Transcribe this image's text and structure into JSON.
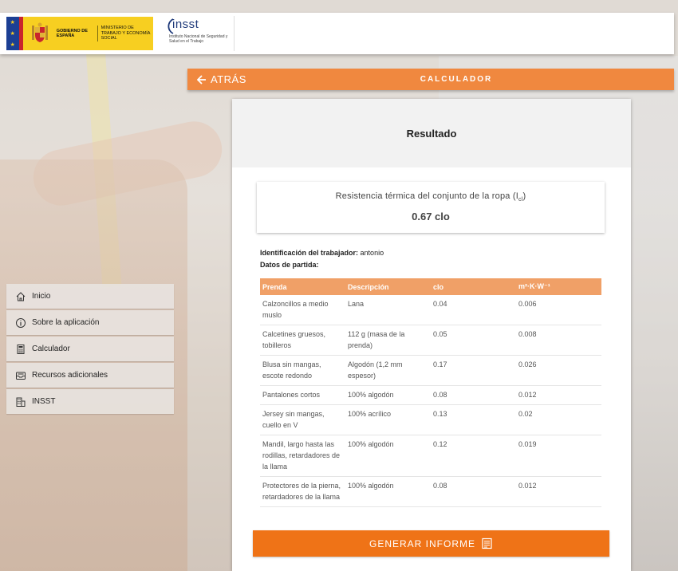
{
  "header": {
    "gobierno_text": "GOBIERNO DE ESPAÑA",
    "ministerio_text": "MINISTERIO DE TRABAJO Y ECONOMÍA SOCIAL",
    "insst_name": "insst",
    "insst_subtitle": "Instituto Nacional de Seguridad y Salud en el Trabajo"
  },
  "topbar": {
    "back_label": "ATRÁS",
    "title": "CALCULADOR"
  },
  "sidenav": {
    "items": [
      {
        "label": "Inicio",
        "icon": "home-icon"
      },
      {
        "label": "Sobre la aplicación",
        "icon": "info-icon"
      },
      {
        "label": "Calculador",
        "icon": "calculator-icon"
      },
      {
        "label": "Recursos adicionales",
        "icon": "inbox-icon"
      },
      {
        "label": "INSST",
        "icon": "building-icon"
      }
    ]
  },
  "card": {
    "title": "Resultado",
    "result_label": "Resistencia térmica del conjunto de la ropa (I",
    "result_sub": "cl",
    "result_label_end": ")",
    "result_value": "0.67 clo",
    "worker_label": "Identificación del trabajador:",
    "worker_value": "antonio",
    "data_label": "Datos de partida:",
    "table": {
      "headers": [
        "Prenda",
        "Descripción",
        "clo",
        "m²·K·W⁻¹"
      ],
      "rows": [
        [
          "Calzoncillos a medio muslo",
          "Lana",
          "0.04",
          "0.006"
        ],
        [
          "Calcetines gruesos, tobilleros",
          "112 g (masa de la prenda)",
          "0.05",
          "0.008"
        ],
        [
          "Blusa sin mangas, escote redondo",
          "Algodón (1,2 mm espesor)",
          "0.17",
          "0.026"
        ],
        [
          "Pantalones cortos",
          "100% algodón",
          "0.08",
          "0.012"
        ],
        [
          "Jersey sin mangas, cuello en V",
          "100% acrílico",
          "0.13",
          "0.02"
        ],
        [
          "Mandil, largo hasta las rodillas, retardadores de la llama",
          "100% algodón",
          "0.12",
          "0.019"
        ],
        [
          "Protectores de la pierna, retardadores de la llama",
          "100% algodón",
          "0.08",
          "0.012"
        ]
      ]
    },
    "button_label": "GENERAR INFORME"
  },
  "colors": {
    "accent": "#ef7317",
    "topbar": "#f0883f",
    "table_header": "#f0a067",
    "gov_yellow": "#f7cf21",
    "insst_blue": "#1f3a7a"
  }
}
